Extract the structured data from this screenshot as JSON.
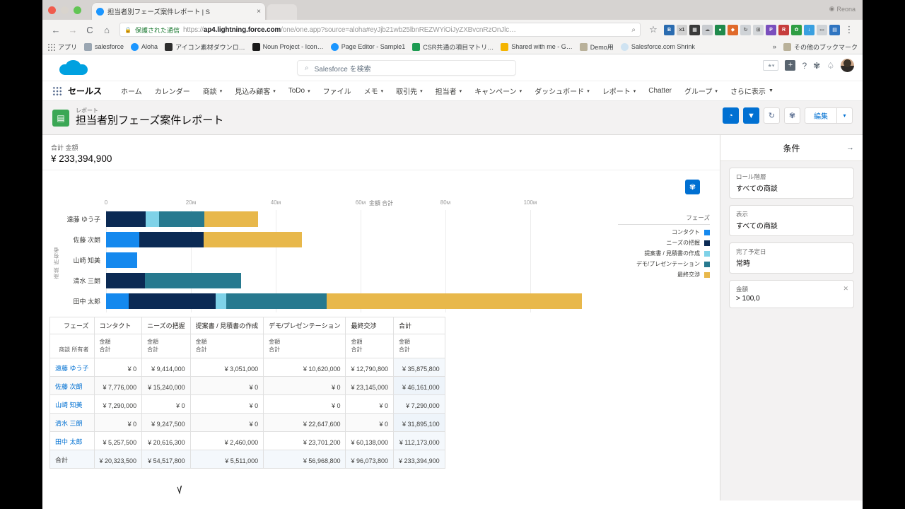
{
  "browser": {
    "tab_title": "担当者別フェーズ案件レポート | S",
    "tab_close": "×",
    "mac_user": "Reona",
    "back_icon": "←",
    "forward_icon": "→",
    "reload_icon": "C",
    "home_icon": "⌂",
    "lock_icon": "🔒",
    "secure_label": "保護された通信",
    "url_prefix": "https://",
    "url_host": "ap4.lightning.force.com",
    "url_path": "/one/one.app?source=aloha#eyJjb21wb25lbnREZWYiOiJyZXBvcnRzOnJlc…",
    "zoom_icon": "⌕",
    "star_icon": "☆",
    "menu_icon": "⋮",
    "bookmarks": [
      {
        "label": "アプリ",
        "type": "grid"
      },
      {
        "label": "salesforce",
        "color": "#9aa6b2"
      },
      {
        "label": "Aloha",
        "color": "#1b96ff"
      },
      {
        "label": "アイコン素材ダウンロ…",
        "color": "#2d2d2d"
      },
      {
        "label": "Noun Project - Icon…",
        "color": "#1a1a1a"
      },
      {
        "label": "Page Editor - Sample1",
        "color": "#1b96ff"
      },
      {
        "label": "CSR共通の項目マトリ…",
        "color": "#1d9b52"
      },
      {
        "label": "Shared with me - G…",
        "color": "#f4b400"
      },
      {
        "label": "Demo用",
        "color": "#b9b19a"
      },
      {
        "label": "Salesforce.com Shrink",
        "color": "#cfe3f2"
      }
    ],
    "overflow_label": "»",
    "other_bookmarks": "その他のブックマーク"
  },
  "sf_header": {
    "search_placeholder": "Salesforce を検索",
    "search_icon": "search-icon",
    "favorites_icon": "star-outline-icon",
    "add_icon": "+",
    "help_icon": "?",
    "setup_icon": "⚙",
    "notification_icon": "🔔",
    "avatar_icon": "user-avatar"
  },
  "nav": {
    "app_launcher": "app-launcher",
    "app_name": "セールス",
    "items": [
      {
        "label": "ホーム",
        "caret": false
      },
      {
        "label": "カレンダー",
        "caret": false
      },
      {
        "label": "商談",
        "caret": true
      },
      {
        "label": "見込み顧客",
        "caret": true
      },
      {
        "label": "ToDo",
        "caret": true
      },
      {
        "label": "ファイル",
        "caret": false
      },
      {
        "label": "メモ",
        "caret": true
      },
      {
        "label": "取引先",
        "caret": true
      },
      {
        "label": "担当者",
        "caret": true
      },
      {
        "label": "キャンペーン",
        "caret": true
      },
      {
        "label": "ダッシュボード",
        "caret": true
      },
      {
        "label": "レポート",
        "caret": true
      },
      {
        "label": "Chatter",
        "caret": false
      },
      {
        "label": "グループ",
        "caret": true
      },
      {
        "label": "さらに表示",
        "caret": true
      }
    ]
  },
  "page_header": {
    "eyebrow": "レポート",
    "title": "担当者別フェーズ案件レポート",
    "icon": "report-icon",
    "actions": {
      "chart_toggle_icon": "pie-chart-icon",
      "filter_icon": "filter-icon",
      "refresh_icon": "refresh-icon",
      "settings_icon": "gear-icon",
      "edit_label": "編集",
      "caret_icon": "▾"
    }
  },
  "summary": {
    "label": "合計 金額",
    "value": "¥ 233,394,900"
  },
  "chart_data": {
    "type": "bar",
    "orientation": "horizontal",
    "stacked": true,
    "title": "金額 合計",
    "xlabel": "",
    "ylabel": "商談 所有者",
    "gear_icon": "chart-settings-icon",
    "grid": true,
    "legend_title": "フェーズ",
    "legend_position": "right",
    "xlim": [
      0,
      120000000
    ],
    "xticks": [
      0,
      20000000,
      40000000,
      60000000,
      80000000,
      100000000
    ],
    "xtick_labels": [
      "0",
      "20м",
      "40м",
      "60м",
      "80м",
      "100м"
    ],
    "categories": [
      "遠藤 ゆう子",
      "佐藤 次朗",
      "山崎 知美",
      "清水 三朗",
      "田中 太郎"
    ],
    "series": [
      {
        "name": "コンタクト",
        "color": "#1589ee",
        "values": [
          0,
          7776000,
          7290000,
          0,
          5257500
        ]
      },
      {
        "name": "ニーズの把握",
        "color": "#0b2a54",
        "values": [
          9414000,
          15240000,
          0,
          9247500,
          20616300
        ]
      },
      {
        "name": "提案書 / 見積書の作成",
        "color": "#7fd2e8",
        "values": [
          3051000,
          0,
          0,
          0,
          2460000
        ]
      },
      {
        "name": "デモ/プレゼンテーション",
        "color": "#27798f",
        "values": [
          10620000,
          0,
          0,
          22647600,
          23701200
        ]
      },
      {
        "name": "最終交渉",
        "color": "#e3b košt",
        "values": [
          12790800,
          23145000,
          0,
          0,
          60138000
        ]
      }
    ],
    "series_colors_hex": [
      "#1589ee",
      "#0b2a54",
      "#7fd2e8",
      "#27798f",
      "#e8b84b"
    ],
    "totals": [
      35875800,
      46161000,
      7290000,
      31895100,
      112173000
    ]
  },
  "table": {
    "header_corner_top": "フェーズ",
    "header_corner_bottom": "商談 所有者",
    "columns": [
      "コンタクト",
      "ニーズの把握",
      "提案書 / 見積書の作成",
      "デモ/プレゼンテーション",
      "最終交渉",
      "合計"
    ],
    "sub_header_line1": "金額",
    "sub_header_line2": "合計",
    "rows": [
      {
        "name": "遠藤 ゆう子",
        "values": [
          "¥ 0",
          "¥ 9,414,000",
          "¥ 3,051,000",
          "¥ 10,620,000",
          "¥ 12,790,800",
          "¥ 35,875,800"
        ]
      },
      {
        "name": "佐藤 次朗",
        "values": [
          "¥ 7,776,000",
          "¥ 15,240,000",
          "¥ 0",
          "¥ 0",
          "¥ 23,145,000",
          "¥ 46,161,000"
        ]
      },
      {
        "name": "山崎 知美",
        "values": [
          "¥ 7,290,000",
          "¥ 0",
          "¥ 0",
          "¥ 0",
          "¥ 0",
          "¥ 7,290,000"
        ]
      },
      {
        "name": "清水 三朗",
        "values": [
          "¥ 0",
          "¥ 9,247,500",
          "¥ 0",
          "¥ 22,647,600",
          "¥ 0",
          "¥ 31,895,100"
        ]
      },
      {
        "name": "田中 太郎",
        "values": [
          "¥ 5,257,500",
          "¥ 20,616,300",
          "¥ 2,460,000",
          "¥ 23,701,200",
          "¥ 60,138,000",
          "¥ 112,173,000"
        ]
      }
    ],
    "total_row": {
      "name": "合計",
      "values": [
        "¥ 20,323,500",
        "¥ 54,517,800",
        "¥ 5,511,000",
        "¥ 56,968,800",
        "¥ 96,073,800",
        "¥ 233,394,900"
      ]
    }
  },
  "filters": {
    "title": "条件",
    "collapse_icon": "→",
    "items": [
      {
        "label": "ロール階層",
        "value": "すべての商談",
        "removable": false
      },
      {
        "label": "表示",
        "value": "すべての商談",
        "removable": false
      },
      {
        "label": "完了予定日",
        "value": "常時",
        "removable": false
      },
      {
        "label": "金額",
        "value": "> 100,0",
        "removable": true,
        "remove_icon": "✕"
      }
    ]
  }
}
